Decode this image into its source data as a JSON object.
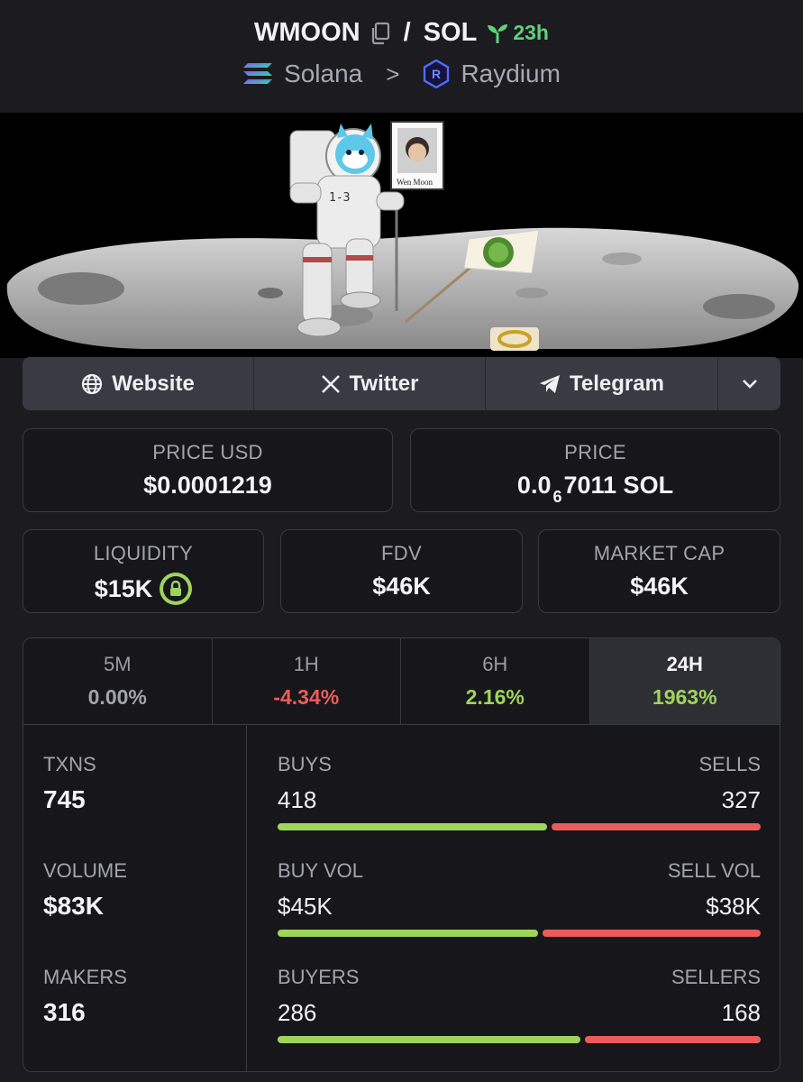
{
  "header": {
    "base_symbol": "WMOON",
    "quote_symbol": "SOL",
    "separator": "/",
    "age": "23h",
    "chain": "Solana",
    "dex": "Raydium",
    "chevron": ">"
  },
  "banner": {
    "flag_text": "Wen Moon",
    "suit_text": "1-3"
  },
  "links": {
    "website": "Website",
    "twitter": "Twitter",
    "telegram": "Telegram"
  },
  "price": {
    "usd_label": "PRICE USD",
    "usd_value": "$0.0001219",
    "native_label": "PRICE",
    "native_prefix": "0.0",
    "native_zeros": "6",
    "native_rest": "7011 SOL"
  },
  "market": {
    "liquidity_label": "LIQUIDITY",
    "liquidity_value": "$15K",
    "fdv_label": "FDV",
    "fdv_value": "$46K",
    "mcap_label": "MARKET CAP",
    "mcap_value": "$46K"
  },
  "tabs": [
    {
      "label": "5M",
      "value": "0.00%",
      "color": "#a3a3ad"
    },
    {
      "label": "1H",
      "value": "-4.34%",
      "color": "#ec5b5b"
    },
    {
      "label": "6H",
      "value": "2.16%",
      "color": "#9fd45b"
    },
    {
      "label": "24H",
      "value": "1963%",
      "color": "#9fd45b",
      "active": true
    }
  ],
  "metrics": {
    "txns_label": "TXNS",
    "txns_value": "745",
    "volume_label": "VOLUME",
    "volume_value": "$83K",
    "makers_label": "MAKERS",
    "makers_value": "316"
  },
  "rows": [
    {
      "left_label": "BUYS",
      "right_label": "SELLS",
      "left_value": "418",
      "right_value": "327",
      "buy_fraction": 0.561
    },
    {
      "left_label": "BUY VOL",
      "right_label": "SELL VOL",
      "left_value": "$45K",
      "right_value": "$38K",
      "buy_fraction": 0.542
    },
    {
      "left_label": "BUYERS",
      "right_label": "SELLERS",
      "left_value": "286",
      "right_value": "168",
      "buy_fraction": 0.63
    }
  ],
  "colors": {
    "buy": "#9fd45b",
    "sell": "#ec5b5b",
    "age": "#5fd07a"
  }
}
